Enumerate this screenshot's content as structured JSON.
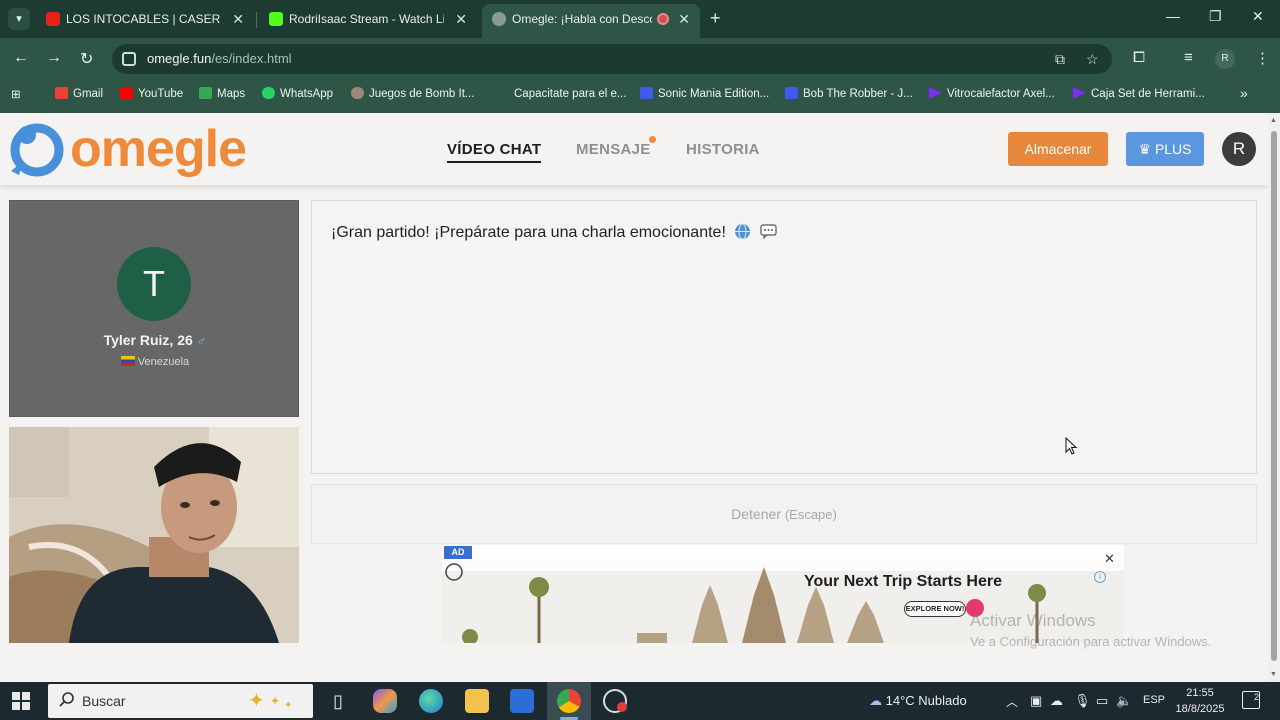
{
  "browser": {
    "tabs": [
      {
        "title": "LOS INTOCABLES | CASERIO TV",
        "favicon_color": "#e62117"
      },
      {
        "title": "RodriIsaac Stream - Watch Live",
        "favicon_color": "#53fc18"
      },
      {
        "title": "Omegle: ¡Habla con Descon",
        "favicon_color": "#8a9a94",
        "active": true
      }
    ],
    "url_host": "omegle.fun",
    "url_path": "/es/index.html",
    "profile_initial": "R"
  },
  "bookmarks": [
    {
      "label": "Gmail",
      "icon_color": "#ea4335"
    },
    {
      "label": "YouTube",
      "icon_color": "#ff0000"
    },
    {
      "label": "Maps",
      "icon_color": "#34a853"
    },
    {
      "label": "WhatsApp",
      "icon_color": "#25d366"
    },
    {
      "label": "Juegos de Bomb It...",
      "icon_color": "#9b8a7a"
    },
    {
      "label": "Capacitate para el e...",
      "icon_color": "#2f5546"
    },
    {
      "label": "Sonic Mania Edition...",
      "icon_color": "#3d5af1"
    },
    {
      "label": "Bob The Robber - J...",
      "icon_color": "#3d5af1"
    },
    {
      "label": "Vitrocalefactor Axel...",
      "icon_color": "#7b2ff7"
    },
    {
      "label": "Caja Set de Herrami...",
      "icon_color": "#7b2ff7"
    }
  ],
  "site": {
    "logo_text": "omegle",
    "nav": [
      {
        "label": "VÍDEO CHAT",
        "active": true
      },
      {
        "label": "MENSAJE",
        "has_dot": true
      },
      {
        "label": "HISTORIA"
      }
    ],
    "store_label": "Almacenar",
    "plus_label": "PLUS",
    "user_initial": "R"
  },
  "stranger": {
    "initial": "T",
    "name": "Tyler Ruiz, 26",
    "gender_icon": "male-icon",
    "country": "Venezuela"
  },
  "chat": {
    "message": "¡Gran partido! ¡Prepárate para una charla emocionante!",
    "emojis": [
      "globe-icon",
      "speech-balloon-icon"
    ]
  },
  "stop": {
    "label": "Detener",
    "hint": "(Escape)"
  },
  "ad": {
    "badge": "AD",
    "title": "Your Next Trip Starts Here",
    "cta": "EXPLORE NOW!"
  },
  "watermark": {
    "line1": "Activar Windows",
    "line2": "Ve a Configuración para activar Windows."
  },
  "taskbar": {
    "search_placeholder": "Buscar",
    "weather": "14°C  Nublado",
    "language": "ESP",
    "time": "21:55",
    "date": "18/8/2025",
    "notifications": "2"
  }
}
